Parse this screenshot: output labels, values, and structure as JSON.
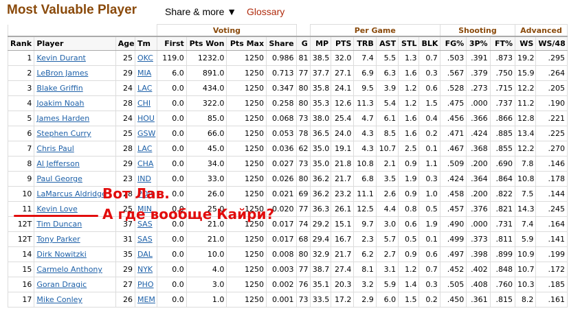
{
  "header": {
    "title": "Most Valuable Player",
    "share_label": "Share & more ▼",
    "glossary_label": "Glossary"
  },
  "groups": {
    "voting": "Voting",
    "per_game": "Per Game",
    "shooting": "Shooting",
    "advanced": "Advanced"
  },
  "columns": [
    "Rank",
    "Player",
    "Age",
    "Tm",
    "First",
    "Pts Won",
    "Pts Max",
    "Share",
    "G",
    "MP",
    "PTS",
    "TRB",
    "AST",
    "STL",
    "BLK",
    "FG%",
    "3P%",
    "FT%",
    "WS",
    "WS/48"
  ],
  "rows": [
    [
      "1",
      "Kevin Durant",
      "25",
      "OKC",
      "119.0",
      "1232.0",
      "1250",
      "0.986",
      "81",
      "38.5",
      "32.0",
      "7.4",
      "5.5",
      "1.3",
      "0.7",
      ".503",
      ".391",
      ".873",
      "19.2",
      ".295"
    ],
    [
      "2",
      "LeBron James",
      "29",
      "MIA",
      "6.0",
      "891.0",
      "1250",
      "0.713",
      "77",
      "37.7",
      "27.1",
      "6.9",
      "6.3",
      "1.6",
      "0.3",
      ".567",
      ".379",
      ".750",
      "15.9",
      ".264"
    ],
    [
      "3",
      "Blake Griffin",
      "24",
      "LAC",
      "0.0",
      "434.0",
      "1250",
      "0.347",
      "80",
      "35.8",
      "24.1",
      "9.5",
      "3.9",
      "1.2",
      "0.6",
      ".528",
      ".273",
      ".715",
      "12.2",
      ".205"
    ],
    [
      "4",
      "Joakim Noah",
      "28",
      "CHI",
      "0.0",
      "322.0",
      "1250",
      "0.258",
      "80",
      "35.3",
      "12.6",
      "11.3",
      "5.4",
      "1.2",
      "1.5",
      ".475",
      ".000",
      ".737",
      "11.2",
      ".190"
    ],
    [
      "5",
      "James Harden",
      "24",
      "HOU",
      "0.0",
      "85.0",
      "1250",
      "0.068",
      "73",
      "38.0",
      "25.4",
      "4.7",
      "6.1",
      "1.6",
      "0.4",
      ".456",
      ".366",
      ".866",
      "12.8",
      ".221"
    ],
    [
      "6",
      "Stephen Curry",
      "25",
      "GSW",
      "0.0",
      "66.0",
      "1250",
      "0.053",
      "78",
      "36.5",
      "24.0",
      "4.3",
      "8.5",
      "1.6",
      "0.2",
      ".471",
      ".424",
      ".885",
      "13.4",
      ".225"
    ],
    [
      "7",
      "Chris Paul",
      "28",
      "LAC",
      "0.0",
      "45.0",
      "1250",
      "0.036",
      "62",
      "35.0",
      "19.1",
      "4.3",
      "10.7",
      "2.5",
      "0.1",
      ".467",
      ".368",
      ".855",
      "12.2",
      ".270"
    ],
    [
      "8",
      "Al Jefferson",
      "29",
      "CHA",
      "0.0",
      "34.0",
      "1250",
      "0.027",
      "73",
      "35.0",
      "21.8",
      "10.8",
      "2.1",
      "0.9",
      "1.1",
      ".509",
      ".200",
      ".690",
      "7.8",
      ".146"
    ],
    [
      "9",
      "Paul George",
      "23",
      "IND",
      "0.0",
      "33.0",
      "1250",
      "0.026",
      "80",
      "36.2",
      "21.7",
      "6.8",
      "3.5",
      "1.9",
      "0.3",
      ".424",
      ".364",
      ".864",
      "10.8",
      ".178"
    ],
    [
      "10",
      "LaMarcus Aldridge",
      "28",
      "POR",
      "0.0",
      "26.0",
      "1250",
      "0.021",
      "69",
      "36.2",
      "23.2",
      "11.1",
      "2.6",
      "0.9",
      "1.0",
      ".458",
      ".200",
      ".822",
      "7.5",
      ".144"
    ],
    [
      "11",
      "Kevin Love",
      "25",
      "MIN",
      "0.0",
      "25.0",
      "1250",
      "0.020",
      "77",
      "36.3",
      "26.1",
      "12.5",
      "4.4",
      "0.8",
      "0.5",
      ".457",
      ".376",
      ".821",
      "14.3",
      ".245"
    ],
    [
      "12T",
      "Tim Duncan",
      "37",
      "SAS",
      "0.0",
      "21.0",
      "1250",
      "0.017",
      "74",
      "29.2",
      "15.1",
      "9.7",
      "3.0",
      "0.6",
      "1.9",
      ".490",
      ".000",
      ".731",
      "7.4",
      ".164"
    ],
    [
      "12T",
      "Tony Parker",
      "31",
      "SAS",
      "0.0",
      "21.0",
      "1250",
      "0.017",
      "68",
      "29.4",
      "16.7",
      "2.3",
      "5.7",
      "0.5",
      "0.1",
      ".499",
      ".373",
      ".811",
      "5.9",
      ".141"
    ],
    [
      "14",
      "Dirk Nowitzki",
      "35",
      "DAL",
      "0.0",
      "10.0",
      "1250",
      "0.008",
      "80",
      "32.9",
      "21.7",
      "6.2",
      "2.7",
      "0.9",
      "0.6",
      ".497",
      ".398",
      ".899",
      "10.9",
      ".199"
    ],
    [
      "15",
      "Carmelo Anthony",
      "29",
      "NYK",
      "0.0",
      "4.0",
      "1250",
      "0.003",
      "77",
      "38.7",
      "27.4",
      "8.1",
      "3.1",
      "1.2",
      "0.7",
      ".452",
      ".402",
      ".848",
      "10.7",
      ".172"
    ],
    [
      "16",
      "Goran Dragic",
      "27",
      "PHO",
      "0.0",
      "3.0",
      "1250",
      "0.002",
      "76",
      "35.1",
      "20.3",
      "3.2",
      "5.9",
      "1.4",
      "0.3",
      ".505",
      ".408",
      ".760",
      "10.3",
      ".185"
    ],
    [
      "17",
      "Mike Conley",
      "26",
      "MEM",
      "0.0",
      "1.0",
      "1250",
      "0.001",
      "73",
      "33.5",
      "17.2",
      "2.9",
      "6.0",
      "1.5",
      "0.2",
      ".450",
      ".361",
      ".815",
      "8.2",
      ".161"
    ]
  ],
  "annotations": {
    "line1": "Вот Лав.",
    "line2": "А где вообще Кайри?",
    "color": "#e20d0d"
  },
  "colors": {
    "title": "#8a4a0b",
    "link": "#1d60a8",
    "glossary": "#b02b0d"
  }
}
